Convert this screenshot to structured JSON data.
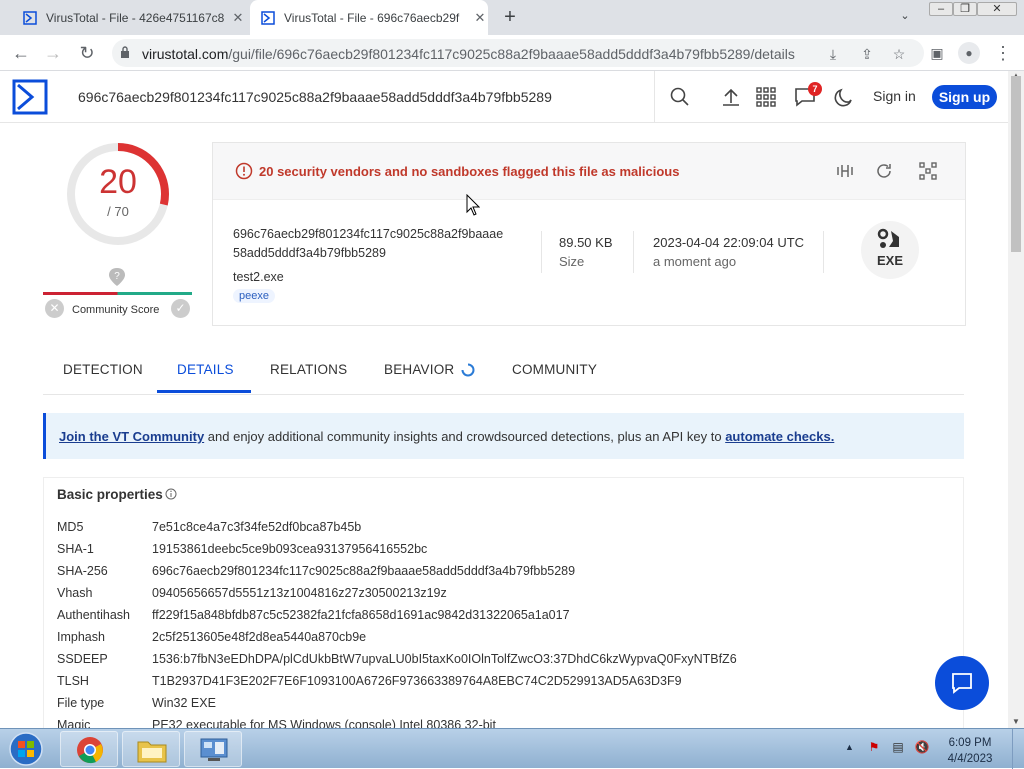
{
  "browser": {
    "tabs": [
      {
        "title": "VirusTotal - File - 426e4751167c8"
      },
      {
        "title": "VirusTotal - File - 696c76aecb29f"
      }
    ],
    "new_tab_symbol": "+",
    "url_host": "virustotal.com",
    "url_path": "/gui/file/696c76aecb29f801234fc117c9025c88a2f9baaae58add5dddf3a4b79fbb5289/details"
  },
  "header": {
    "search_value": "696c76aecb29f801234fc117c9025c88a2f9baaae58add5dddf3a4b79fbb5289",
    "notification_count": "7",
    "sign_in": "Sign in",
    "sign_up": "Sign up"
  },
  "score": {
    "detections": "20",
    "total": "/ 70",
    "detection_fraction": 0.2857,
    "community_label": "Community Score"
  },
  "file": {
    "alert": "20 security vendors and no sandboxes flagged this file as malicious",
    "hash_line1": "696c76aecb29f801234fc117c9025c88a2f9baaae",
    "hash_line2": "58add5dddf3a4b79fbb5289",
    "name": "test2.exe",
    "tag": "peexe",
    "size": "89.50 KB",
    "size_label": "Size",
    "date": "2023-04-04 22:09:04 UTC",
    "date_label": "a moment ago",
    "type_label": "EXE"
  },
  "tabs": [
    "DETECTION",
    "DETAILS",
    "RELATIONS",
    "BEHAVIOR",
    "COMMUNITY"
  ],
  "banner": {
    "link1": "Join the VT Community",
    "text": " and enjoy additional community insights and crowdsourced detections, plus an API key to ",
    "link2": "automate checks."
  },
  "basic_properties": {
    "title": "Basic properties",
    "rows": [
      {
        "key": "MD5",
        "value": "7e51c8ce4a7c3f34fe52df0bca87b45b"
      },
      {
        "key": "SHA-1",
        "value": "19153861deebc5ce9b093cea93137956416552bc"
      },
      {
        "key": "SHA-256",
        "value": "696c76aecb29f801234fc117c9025c88a2f9baaae58add5dddf3a4b79fbb5289"
      },
      {
        "key": "Vhash",
        "value": "09405656657d5551z13z1004816z27z30500213z19z"
      },
      {
        "key": "Authentihash",
        "value": "ff229f15a848bfdb87c5c52382fa21fcfa8658d1691ac9842d31322065a1a017"
      },
      {
        "key": "Imphash",
        "value": "2c5f2513605e48f2d8ea5440a870cb9e"
      },
      {
        "key": "SSDEEP",
        "value": "1536:b7fbN3eEDhDPA/plCdUkbBtW7upvaLU0bI5taxKo0IOlnTolfZwcO3:37DhdC6kzWypvaQ0FxyNTBfZ6"
      },
      {
        "key": "TLSH",
        "value": "T1B2937D41F3E202F7E6F1093100A6726F973663389764A8EBC74C2D529913AD5A63D3F9"
      },
      {
        "key": "File type",
        "value": "Win32 EXE"
      },
      {
        "key": "Magic",
        "value": "PE32 executable for MS Windows (console) Intel 80386 32-bit"
      }
    ]
  },
  "taskbar": {
    "time": "6:09 PM",
    "date": "4/4/2023"
  },
  "colors": {
    "brand": "#0b4dda",
    "alert": "#c0392b"
  }
}
